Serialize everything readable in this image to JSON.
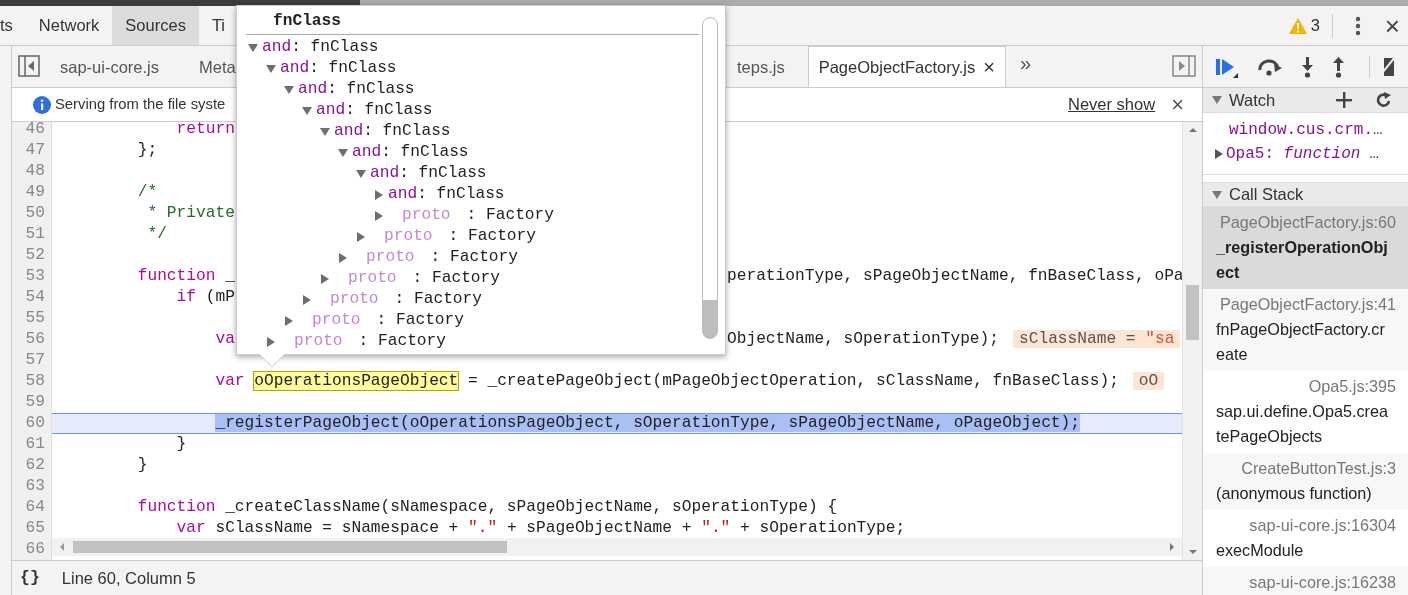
{
  "top_tabs": [
    {
      "label": "ts",
      "selected": false
    },
    {
      "label": "Network",
      "selected": false
    },
    {
      "label": "Sources",
      "selected": true
    },
    {
      "label": "Ti",
      "selected": false
    }
  ],
  "header_right": {
    "warning_count": "3",
    "close": "×"
  },
  "file_tabs": [
    {
      "label": "sap-ui-core.js",
      "selected": false
    },
    {
      "label": "Meta",
      "selected": false
    },
    {
      "label": "teps.js",
      "selected": false
    },
    {
      "label": "PageObjectFactory.js",
      "selected": true,
      "close": "×"
    }
  ],
  "more_tabs": "»",
  "infobar": {
    "message": "Serving from the file syste",
    "link": "Never show",
    "close": "×"
  },
  "code_lines": [
    {
      "number": "46",
      "current": false,
      "code": [
        {
          "kind": "keyword",
          "text": "            return"
        }
      ]
    },
    {
      "number": "47",
      "current": false,
      "code": [
        {
          "kind": "plain",
          "text": "        };"
        }
      ]
    },
    {
      "number": "48",
      "current": false
    },
    {
      "number": "49",
      "current": false,
      "code": [
        {
          "kind": "comment",
          "text": "        /*"
        }
      ]
    },
    {
      "number": "50",
      "current": false,
      "code": [
        {
          "kind": "comment",
          "text": "         * Private"
        }
      ]
    },
    {
      "number": "51",
      "current": false,
      "code": [
        {
          "kind": "comment",
          "text": "         */"
        }
      ]
    },
    {
      "number": "52",
      "current": false
    },
    {
      "number": "53",
      "current": false,
      "code": [
        {
          "kind": "keyword",
          "text": "        function"
        },
        {
          "kind": "plain",
          "text": " _"
        }
      ],
      "after": [
        {
          "kind": "plain",
          "text": "perationType, sPageObjectName, fnBaseClass, oPa"
        }
      ]
    },
    {
      "number": "54",
      "current": false,
      "code": [
        {
          "kind": "keyword",
          "text": "            if"
        },
        {
          "kind": "plain",
          "text": " (mP"
        }
      ]
    },
    {
      "number": "55",
      "current": false
    },
    {
      "number": "56",
      "current": false,
      "code": [
        {
          "kind": "keyword",
          "text": "                va"
        }
      ],
      "after": [
        {
          "kind": "plain",
          "text": "ObjectName, sOperationType);"
        }
      ],
      "value": {
        "name": "sClassName = ",
        "text": "\"sa"
      }
    },
    {
      "number": "57",
      "current": false
    },
    {
      "number": "58",
      "current": false,
      "code": [
        {
          "kind": "keyword",
          "text": "                var "
        },
        {
          "kind": "match",
          "text": "oOperationsPageObject"
        },
        {
          "kind": "plain",
          "text": " = _createPageObject(mPageObjectOperation, sClassName, fnBaseClass);"
        }
      ],
      "value": {
        "name": "oO"
      }
    },
    {
      "number": "59",
      "current": false
    },
    {
      "number": "60",
      "current": true,
      "code": [
        {
          "kind": "plain",
          "text": "                _registerPageObject(oOperationsPageObject, sOperationType, sPageObjectName, oPageObject);"
        }
      ]
    },
    {
      "number": "61",
      "current": false,
      "code": [
        {
          "kind": "plain",
          "text": "            }"
        }
      ]
    },
    {
      "number": "62",
      "current": false,
      "code": [
        {
          "kind": "plain",
          "text": "        }"
        }
      ]
    },
    {
      "number": "63",
      "current": false
    },
    {
      "number": "64",
      "current": false,
      "code": [
        {
          "kind": "keyword",
          "text": "        function"
        },
        {
          "kind": "plain",
          "text": " _createClassName(sNamespace, sPageObjectName, sOperationType) {"
        }
      ]
    },
    {
      "number": "65",
      "current": false,
      "code": [
        {
          "kind": "keyword",
          "text": "            var"
        },
        {
          "kind": "plain",
          "text": " sClassName = sNamespace + "
        },
        {
          "kind": "string",
          "text": "\".\""
        },
        {
          "kind": "plain",
          "text": " + sPageObjectName + "
        },
        {
          "kind": "string",
          "text": "\".\""
        },
        {
          "kind": "plain",
          "text": " + sOperationType;"
        }
      ]
    },
    {
      "number": "66",
      "current": false
    }
  ],
  "status_bar": {
    "format": "{}",
    "position": "Line 60, Column 5"
  },
  "popover": {
    "title": "fnClass",
    "tree": [
      {
        "name": "and",
        "value": ": fnClass",
        "enumerable": true,
        "expanded": true,
        "children": [
          {
            "name": "and",
            "value": ": fnClass",
            "enumerable": true,
            "expanded": true,
            "children": [
              {
                "name": "and",
                "value": ": fnClass",
                "enumerable": true,
                "expanded": true,
                "children": [
                  {
                    "name": "and",
                    "value": ": fnClass",
                    "enumerable": true,
                    "expanded": true,
                    "children": [
                      {
                        "name": "and",
                        "value": ": fnClass",
                        "enumerable": true,
                        "expanded": true,
                        "children": [
                          {
                            "name": "and",
                            "value": ": fnClass",
                            "enumerable": true,
                            "expanded": true,
                            "children": [
                              {
                                "name": "and",
                                "value": ": fnClass",
                                "enumerable": true,
                                "expanded": true,
                                "children": [
                                  {
                                    "name": "and",
                                    "value": ": fnClass",
                                    "enumerable": true,
                                    "expanded": false
                                  },
                                  {
                                    "name": "proto",
                                    "value": ": Factory",
                                    "enumerable": false,
                                    "expanded": false
                                  }
                                ]
                              },
                              {
                                "name": "proto",
                                "value": ": Factory",
                                "enumerable": false,
                                "expanded": false
                              }
                            ]
                          },
                          {
                            "name": "proto",
                            "value": ": Factory",
                            "enumerable": false,
                            "expanded": false
                          }
                        ]
                      },
                      {
                        "name": "proto",
                        "value": ": Factory",
                        "enumerable": false,
                        "expanded": false
                      }
                    ]
                  },
                  {
                    "name": "proto",
                    "value": ": Factory",
                    "enumerable": false,
                    "expanded": false
                  }
                ]
              },
              {
                "name": "proto",
                "value": ": Factory",
                "enumerable": false,
                "expanded": false
              }
            ]
          },
          {
            "name": "proto",
            "value": ": Factory",
            "enumerable": false,
            "expanded": false
          }
        ]
      }
    ]
  },
  "sidebar": {
    "watch": {
      "title": "Watch",
      "expanded": true,
      "items": [
        {
          "kind": "expression",
          "name": "window.cus.crm.…"
        },
        {
          "kind": "property",
          "name": "Opa5:",
          "value": "function …",
          "expanded": false
        }
      ]
    },
    "call_stack": {
      "title": "Call Stack",
      "expanded": true,
      "frames": [
        {
          "location": "PageObjectFactory.js:60",
          "function": "_registerOperationObject",
          "selected": true
        },
        {
          "location": "PageObjectFactory.js:41",
          "function": "fnPageObjectFactory.create",
          "selected": false
        },
        {
          "location": "Opa5.js:395",
          "function": "sap.ui.define.Opa5.createPageObjects",
          "selected": false
        },
        {
          "location": "CreateButtonTest.js:3",
          "function": "(anonymous function)",
          "selected": false
        },
        {
          "location": "sap-ui-core.js:16304",
          "function": "execModule",
          "selected": false
        },
        {
          "location": "sap-ui-core.js:16238",
          "selected": false
        }
      ]
    }
  }
}
